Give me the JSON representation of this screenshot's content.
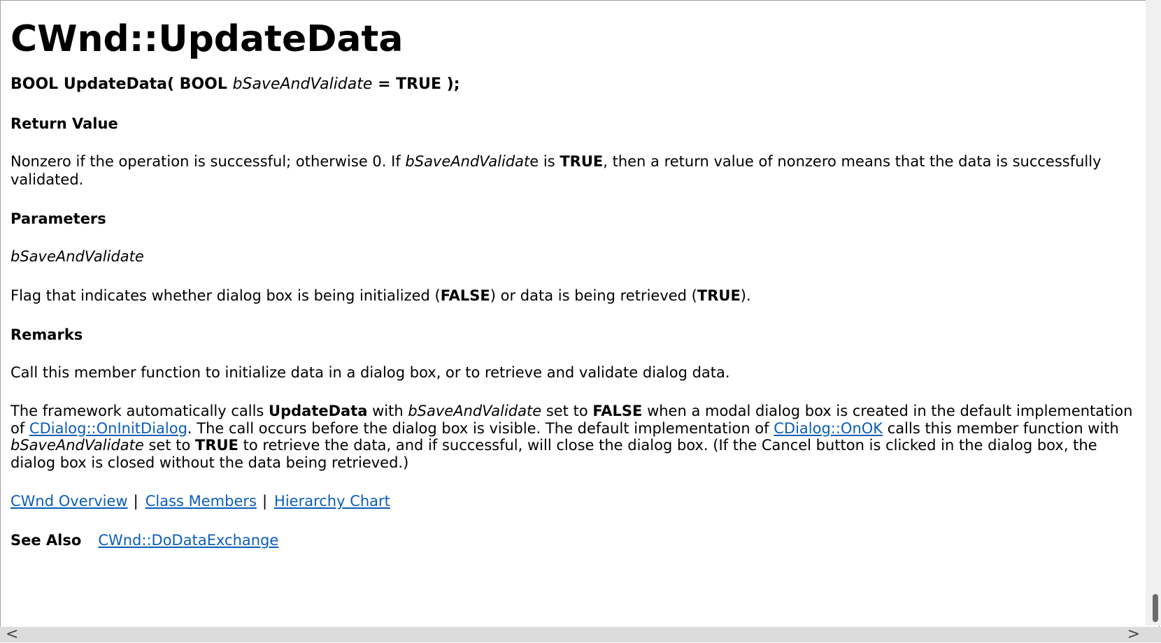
{
  "title": "CWnd::UpdateData",
  "signature": {
    "part1": "BOOL UpdateData( BOOL ",
    "param": "bSaveAndValidate",
    "part2": " = TRUE );"
  },
  "return_value": {
    "heading": "Return Value",
    "t1": "Nonzero if the operation is successful; otherwise 0. If ",
    "t2": "bSaveAndValidat",
    "t3": "e is ",
    "t4": "TRUE",
    "t5": ", then a return value of nonzero means that the data is successfully validated."
  },
  "parameters": {
    "heading": "Parameters",
    "name": "bSaveAndValidate",
    "d1": "Flag that indicates whether dialog box is being initialized (",
    "d2": "FALSE",
    "d3": ") or data is being retrieved (",
    "d4": "TRUE",
    "d5": ")."
  },
  "remarks": {
    "heading": "Remarks",
    "p1": "Call this member function to initialize data in a dialog box, or to retrieve and validate dialog data.",
    "p2a": "The framework automatically calls ",
    "p2b": "UpdateData",
    "p2c": " with ",
    "p2d": "bSaveAndValidate",
    "p2e": " set to ",
    "p2f": "FALSE",
    "p2g": " when a modal dialog box is created in the default implementation of ",
    "p2h_link": "CDialog::OnInitDialog",
    "p2i": ". The call occurs before the dialog box is visible. The default implementation of ",
    "p2j_link": "CDialog::OnOK",
    "p2k": " calls this member function with ",
    "p2l": "bSaveAndValidate",
    "p2m": " set to ",
    "p2n": "TRUE",
    "p2o": " to retrieve the data, and if successful, will close the dialog box. (If the Cancel button is clicked in the dialog box, the dialog box is closed without the data being retrieved.)"
  },
  "nav_links": {
    "overview": "CWnd Overview",
    "separator": "|",
    "members": "Class Members",
    "hierarchy": "Hierarchy Chart"
  },
  "see_also": {
    "label": "See Also",
    "link": "CWnd::DoDataExchange"
  },
  "scrollbar": {
    "left_arrow": "<",
    "right_arrow": ">"
  },
  "colors": {
    "link": "#0b5db8",
    "text": "#000000",
    "background": "#ffffff"
  }
}
